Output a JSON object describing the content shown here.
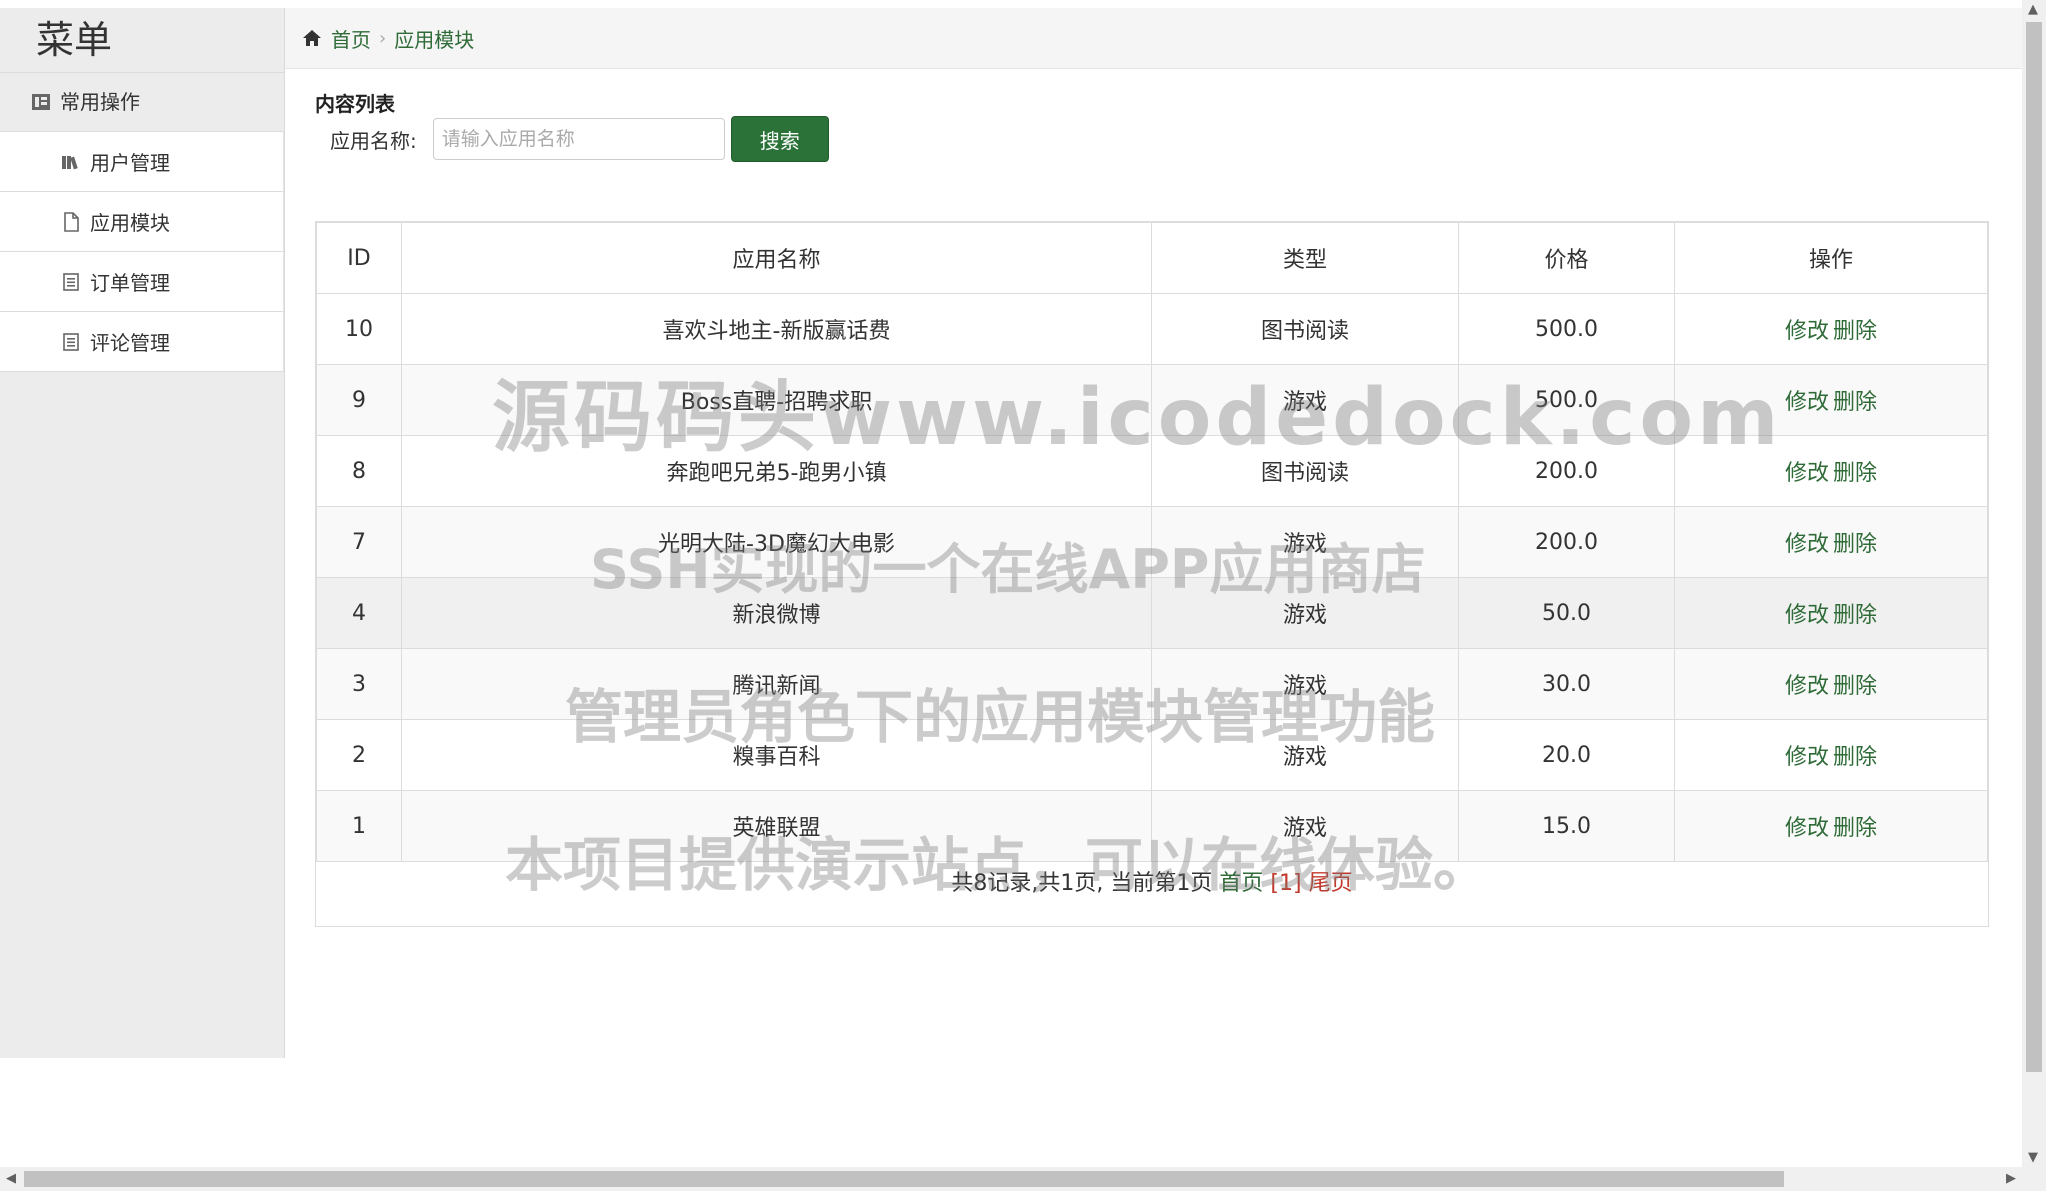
{
  "sidebar": {
    "title": "菜单",
    "group": "常用操作",
    "items": [
      {
        "label": "用户管理",
        "icon": "books-icon"
      },
      {
        "label": "应用模块",
        "icon": "file-icon"
      },
      {
        "label": "订单管理",
        "icon": "list-icon"
      },
      {
        "label": "评论管理",
        "icon": "list-icon"
      }
    ]
  },
  "breadcrumb": {
    "home": "首页",
    "current": "应用模块"
  },
  "main": {
    "section_title": "内容列表",
    "search_label": "应用名称:",
    "search_placeholder": "请输入应用名称",
    "search_button": "搜索"
  },
  "table": {
    "headers": [
      "ID",
      "应用名称",
      "类型",
      "价格",
      "操作"
    ],
    "rows": [
      {
        "id": "10",
        "name": "喜欢斗地主-新版赢话费",
        "type": "图书阅读",
        "price": "500.0"
      },
      {
        "id": "9",
        "name": "Boss直聘-招聘求职",
        "type": "游戏",
        "price": "500.0"
      },
      {
        "id": "8",
        "name": "奔跑吧兄弟5-跑男小镇",
        "type": "图书阅读",
        "price": "200.0"
      },
      {
        "id": "7",
        "name": "光明大陆-3D魔幻大电影",
        "type": "游戏",
        "price": "200.0"
      },
      {
        "id": "4",
        "name": "新浪微博",
        "type": "游戏",
        "price": "50.0"
      },
      {
        "id": "3",
        "name": "腾讯新闻",
        "type": "游戏",
        "price": "30.0"
      },
      {
        "id": "2",
        "name": "糗事百科",
        "type": "游戏",
        "price": "20.0"
      },
      {
        "id": "1",
        "name": "英雄联盟",
        "type": "游戏",
        "price": "15.0"
      }
    ],
    "edit_label": "修改",
    "delete_label": "删除"
  },
  "pager": {
    "summary": "共8记录,共1页, 当前第1页",
    "first": "首页",
    "current": "[1]",
    "last": "尾页"
  },
  "watermark": [
    "源码码头www.icodedock.com",
    "SSH实现的一个在线APP应用商店",
    "管理员角色下的应用模块管理功能",
    "本项目提供演示站点，可以在线体验。"
  ]
}
